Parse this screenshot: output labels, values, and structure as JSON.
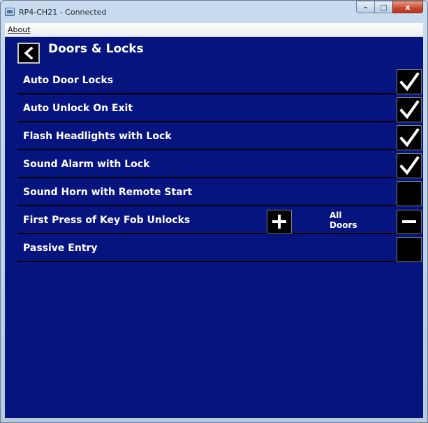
{
  "window": {
    "title": "RP4-CH21 - Connected",
    "controls": {
      "minimize": "–",
      "maximize": "□",
      "close": "x"
    }
  },
  "menu": {
    "items": [
      "About"
    ]
  },
  "header": {
    "back_label": "<",
    "title": "Doors & Locks"
  },
  "settings": [
    {
      "label": "Auto Door Locks",
      "type": "checkbox",
      "checked": true
    },
    {
      "label": "Auto Unlock On Exit",
      "type": "checkbox",
      "checked": true
    },
    {
      "label": "Flash Headlights with Lock",
      "type": "checkbox",
      "checked": true
    },
    {
      "label": "Sound Alarm with Lock",
      "type": "checkbox",
      "checked": true
    },
    {
      "label": "Sound Horn with Remote Start",
      "type": "checkbox",
      "checked": false
    },
    {
      "label": "First Press of Key Fob Unlocks",
      "type": "stepper",
      "value": "All\nDoors",
      "plus": "+",
      "minus": "−"
    },
    {
      "label": "Passive Entry",
      "type": "checkbox",
      "checked": false
    }
  ],
  "colors": {
    "background": "#06147f",
    "control_bg": "#000000",
    "text": "#ffffff"
  },
  "icons": {
    "app": "app-window-icon",
    "back": "chevron-left-icon",
    "check": "checkmark-icon",
    "plus": "plus-icon",
    "minus": "minus-icon"
  }
}
